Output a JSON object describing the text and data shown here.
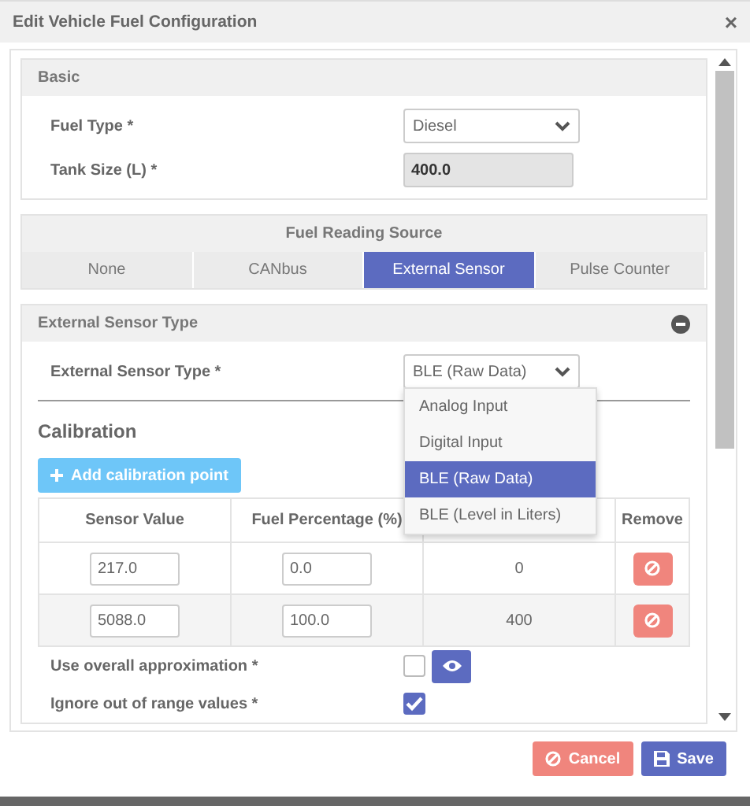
{
  "window": {
    "title": "Edit Vehicle Fuel Configuration",
    "close": "×"
  },
  "basic": {
    "title": "Basic",
    "fuel_type": {
      "label": "Fuel Type  *",
      "value": "Diesel"
    },
    "tank_size": {
      "label": "Tank Size (L)  *",
      "value": "400.0",
      "disabled": true
    }
  },
  "source": {
    "title": "Fuel Reading Source",
    "tabs": [
      {
        "label": "None",
        "selected": false
      },
      {
        "label": "CANbus",
        "selected": false
      },
      {
        "label": "External Sensor",
        "selected": true
      },
      {
        "label": "Pulse Counter",
        "selected": false
      }
    ]
  },
  "external": {
    "title": "External Sensor Type",
    "sensor_type": {
      "label": "External Sensor Type  *",
      "value": "BLE (Raw Data)",
      "expanded": true,
      "options": [
        {
          "label": "Analog Input",
          "selected": false
        },
        {
          "label": "Digital Input",
          "selected": false
        },
        {
          "label": "BLE (Raw Data)",
          "selected": true
        },
        {
          "label": "BLE (Level in Liters)",
          "selected": false
        }
      ]
    },
    "calibration": {
      "title": "Calibration",
      "add_button": "Add calibration point",
      "columns": [
        "Sensor Value",
        "Fuel Percentage (%)",
        "Remove"
      ],
      "rows": [
        {
          "sensor_value": "217.0",
          "fuel_percentage": "0.0",
          "column_3": "0"
        },
        {
          "sensor_value": "5088.0",
          "fuel_percentage": "100.0",
          "column_3": "400"
        }
      ]
    },
    "options": [
      {
        "label": "Use overall approximation  *",
        "checked": false,
        "view_button": true
      },
      {
        "label": "Ignore out of range values  *",
        "checked": true,
        "view_button": false
      }
    ]
  },
  "buttons": {
    "cancel": "Cancel",
    "save": "Save"
  }
}
